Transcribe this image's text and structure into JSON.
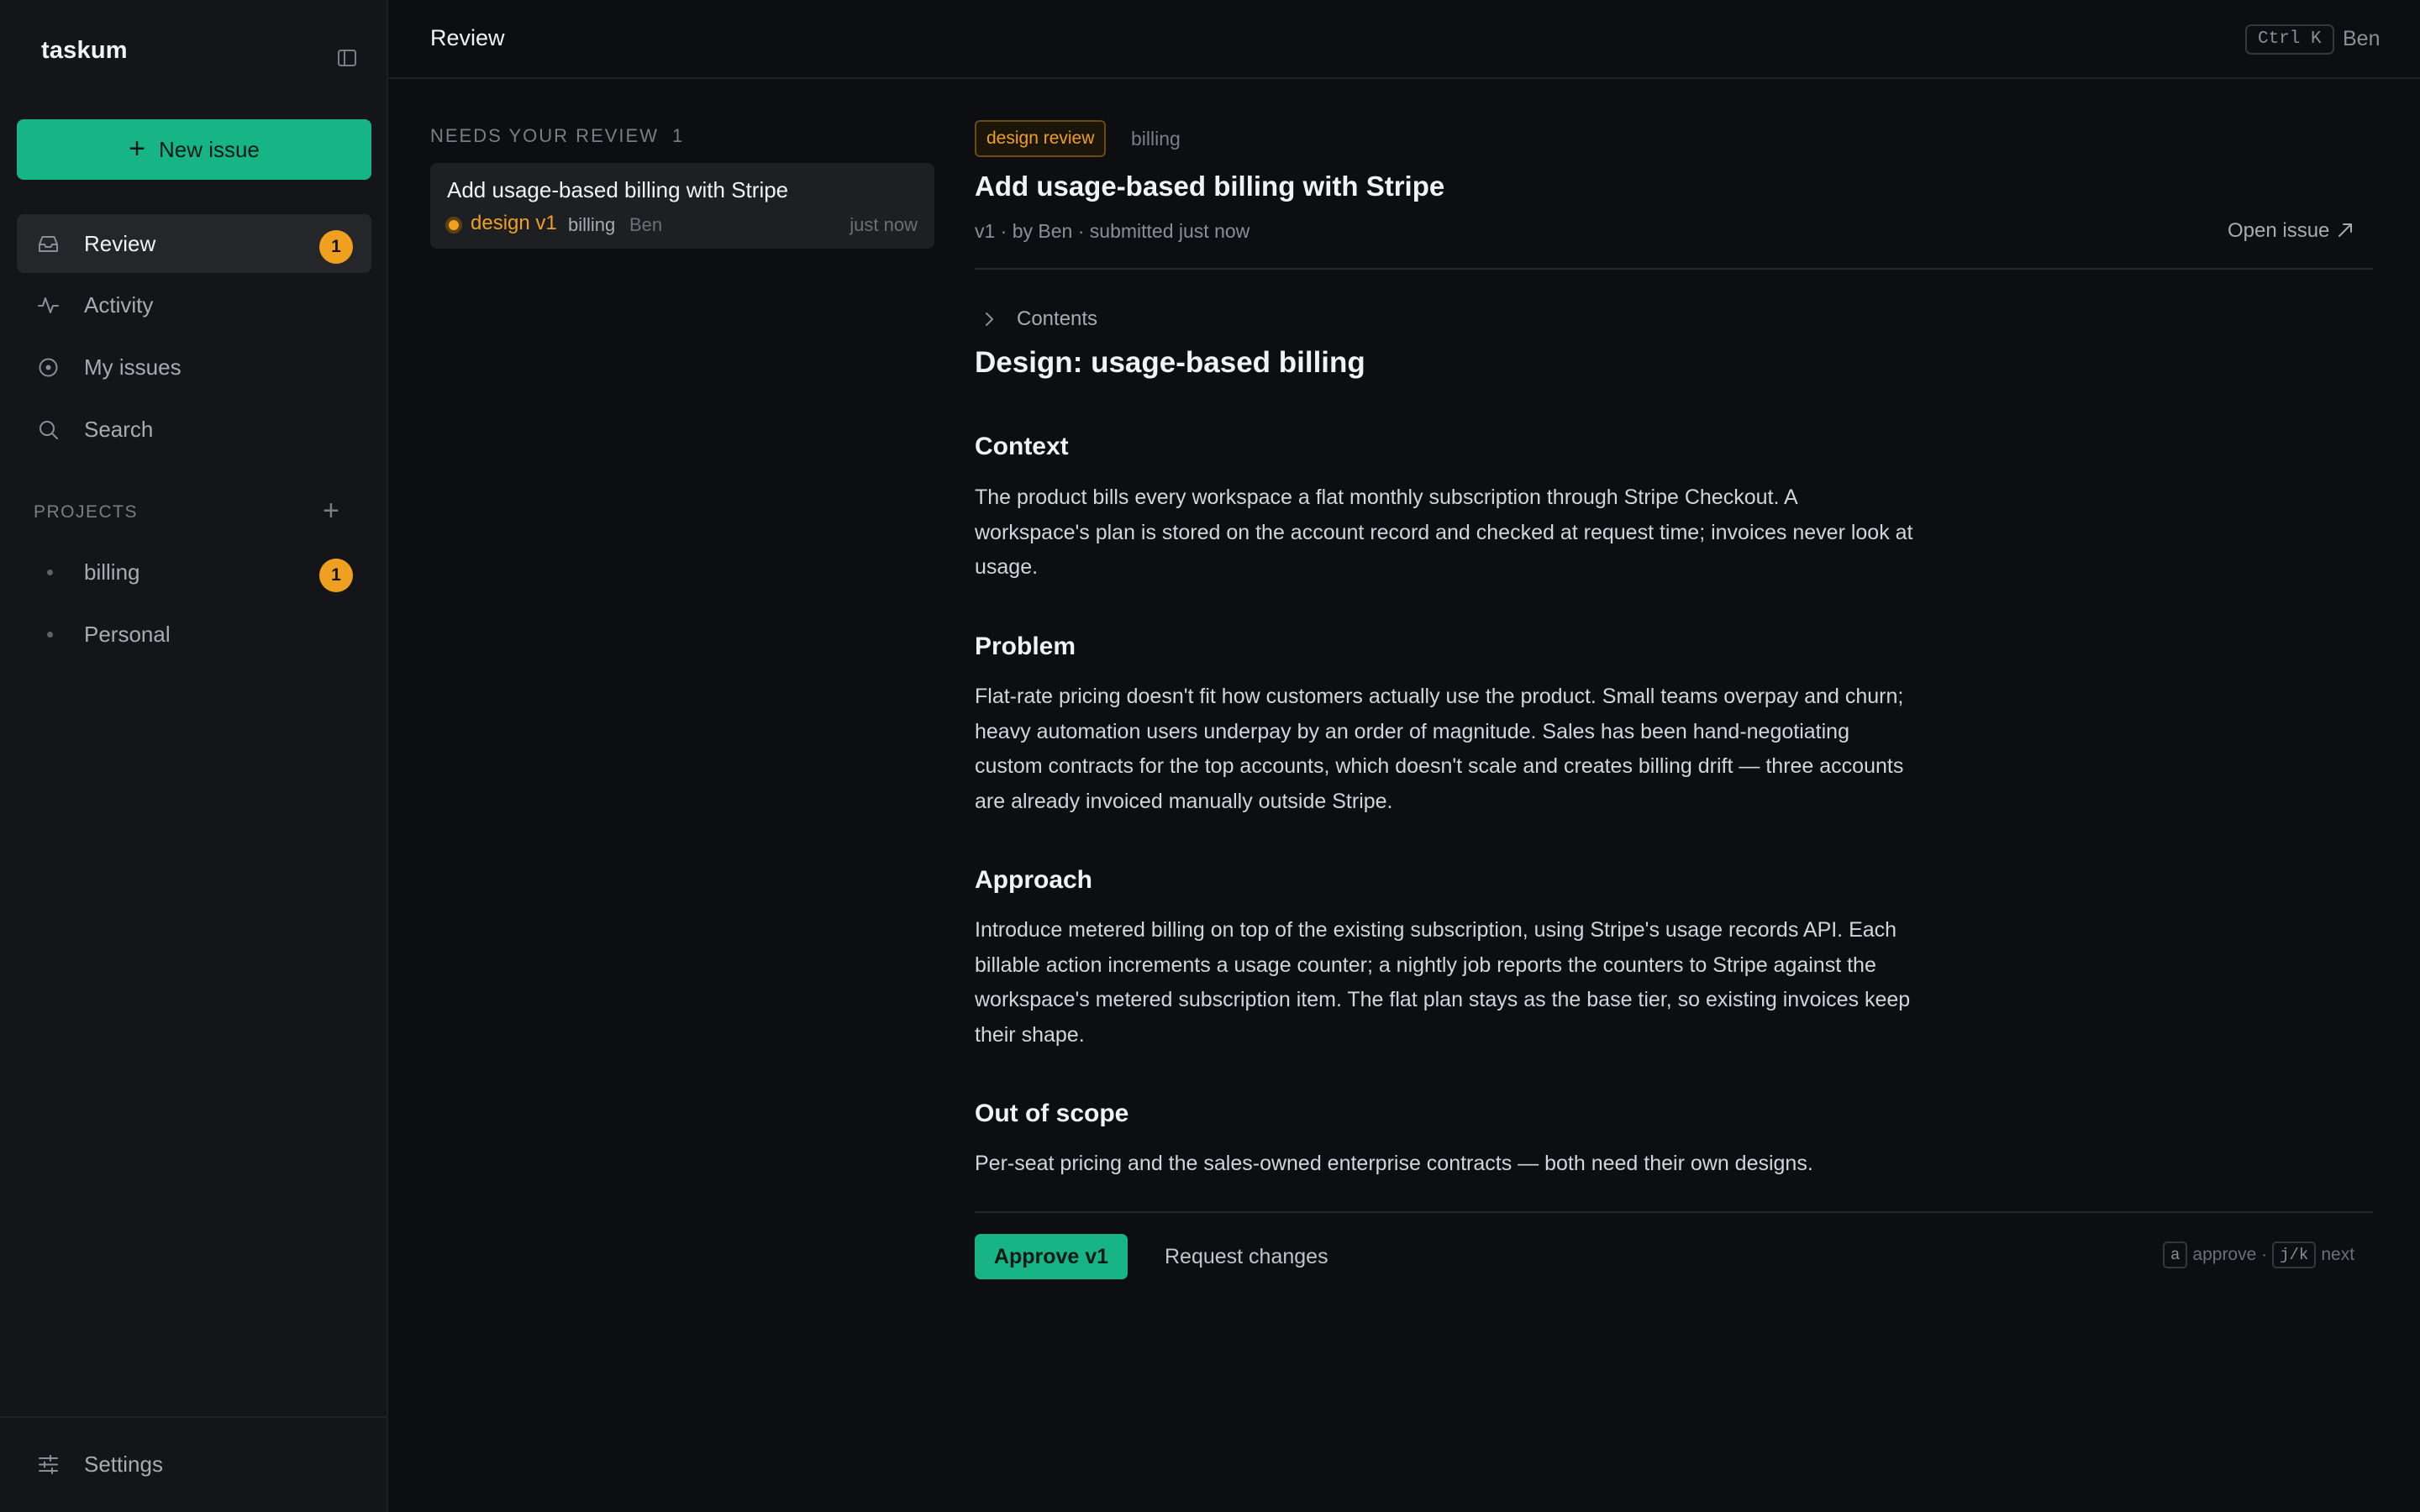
{
  "app": {
    "name": "taskum"
  },
  "sidebar": {
    "new_issue_label": "New issue",
    "nav": [
      {
        "label": "Review",
        "icon": "inbox-icon",
        "badge": "1",
        "active": true
      },
      {
        "label": "Activity",
        "icon": "activity-icon"
      },
      {
        "label": "My issues",
        "icon": "circle-dot-icon"
      },
      {
        "label": "Search",
        "icon": "search-icon"
      }
    ],
    "projects_header": "PROJECTS",
    "projects": [
      {
        "label": "billing",
        "badge": "1"
      },
      {
        "label": "Personal"
      }
    ],
    "settings_label": "Settings"
  },
  "topbar": {
    "title": "Review",
    "shortcut": "Ctrl K",
    "user": "Ben"
  },
  "review_list": {
    "header": "NEEDS YOUR REVIEW",
    "count": "1",
    "items": [
      {
        "title": "Add usage-based billing with Stripe",
        "tag": "design v1",
        "project": "billing",
        "author": "Ben",
        "time": "just now"
      }
    ]
  },
  "detail": {
    "tag": "design review",
    "project": "billing",
    "title": "Add usage-based billing with Stripe",
    "meta": "v1 · by Ben · submitted just now",
    "open_issue_label": "Open issue",
    "contents_label": "Contents",
    "doc_title": "Design: usage-based billing",
    "sections": [
      {
        "heading": "Context",
        "body": "The product bills every workspace a flat monthly subscription through Stripe Checkout. A workspace's plan is stored on the account record and checked at request time; invoices never look at usage."
      },
      {
        "heading": "Problem",
        "body": "Flat-rate pricing doesn't fit how customers actually use the product. Small teams overpay and churn; heavy automation users underpay by an order of magnitude. Sales has been hand-negotiating custom contracts for the top accounts, which doesn't scale and creates billing drift — three accounts are already invoiced manually outside Stripe."
      },
      {
        "heading": "Approach",
        "body": "Introduce metered billing on top of the existing subscription, using Stripe's usage records API. Each billable action increments a usage counter; a nightly job reports the counters to Stripe against the workspace's metered subscription item. The flat plan stays as the base tier, so existing invoices keep their shape."
      },
      {
        "heading": "Out of scope",
        "body": "Per-seat pricing and the sales-owned enterprise contracts — both need their own designs."
      }
    ],
    "approve_label": "Approve v1",
    "request_changes_label": "Request changes",
    "hints": {
      "approve_key": "a",
      "approve_text": "approve ·",
      "next_key": "j/k",
      "next_text": "next"
    }
  },
  "colors": {
    "accent": "#17b585",
    "warning": "#f0a020",
    "background": "#0d0e11",
    "sidebar": "#141518"
  }
}
